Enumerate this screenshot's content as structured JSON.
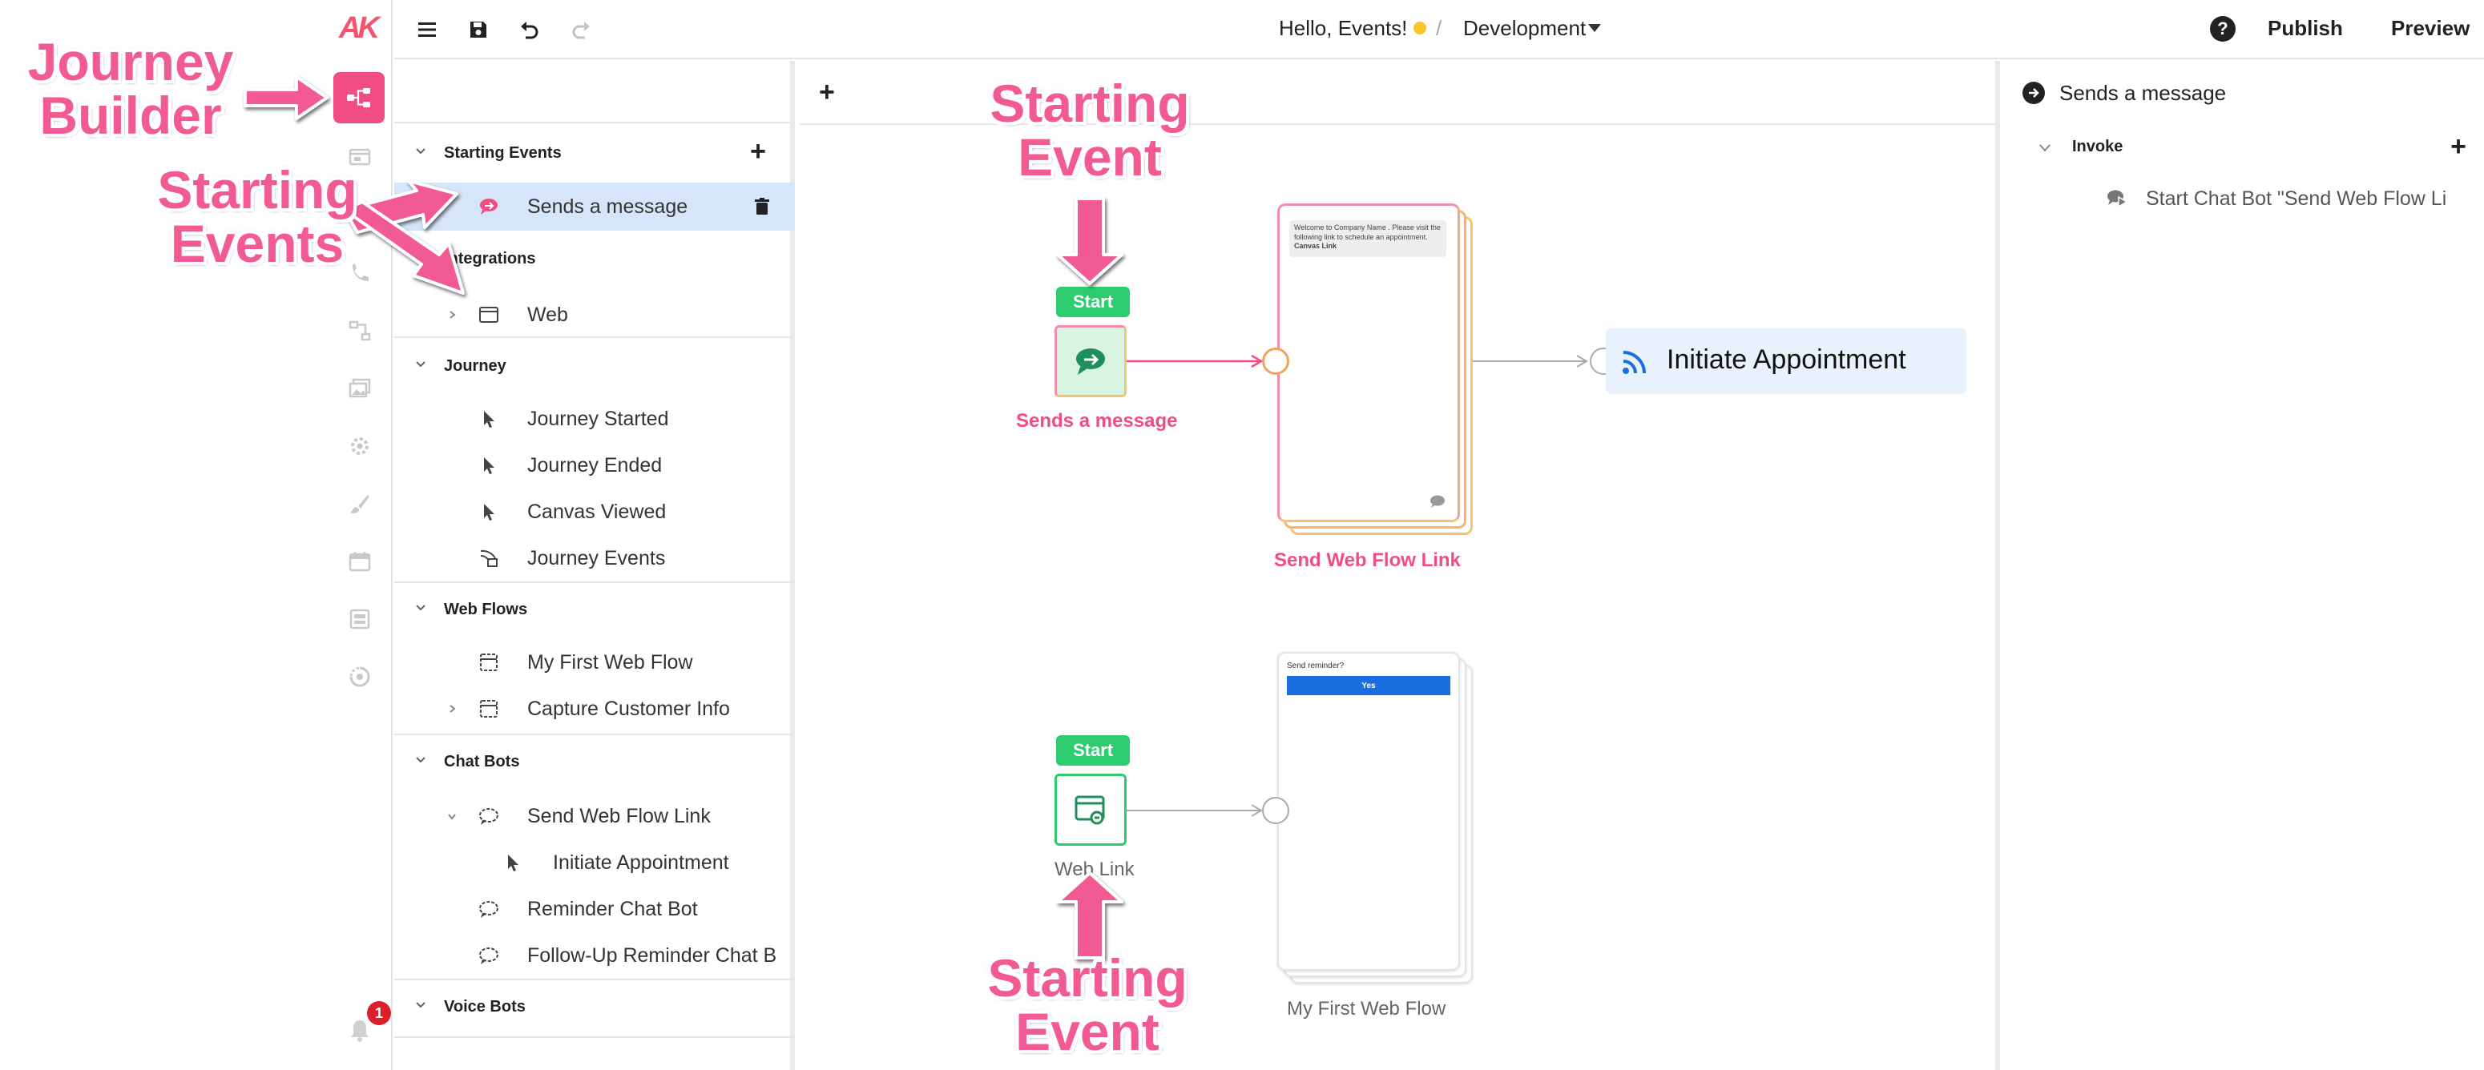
{
  "topbar": {
    "greeting": "Hello, Events!",
    "separator": "/",
    "environment": "Development",
    "help_label": "?",
    "publish_label": "Publish",
    "preview_label": "Preview"
  },
  "rail": {
    "logo": "AK",
    "notification_count": "1"
  },
  "left_panel": {
    "sections": [
      {
        "title": "Starting Events",
        "add": "+"
      },
      {
        "title": "Journey"
      },
      {
        "title": "Web Flows"
      },
      {
        "title": "Chat Bots"
      },
      {
        "title": "Voice Bots"
      }
    ],
    "starting_events": {
      "selected_item": "Sends a message",
      "integrations_title": "Integrations",
      "web_item": "Web"
    },
    "journey_items": [
      "Journey Started",
      "Journey Ended",
      "Canvas Viewed",
      "Journey Events"
    ],
    "web_flow_items": [
      "My First Web Flow",
      "Capture Customer Info"
    ],
    "chat_bot_items": [
      "Send Web Flow Link",
      "Initiate Appointment",
      "Reminder Chat Bot",
      "Follow-Up Reminder Chat B"
    ]
  },
  "canvas": {
    "add": "+",
    "flow1": {
      "start": "Start",
      "trigger_label": "Sends a message",
      "card_label": "Send Web Flow Link",
      "card_preview_text": "Welcome to   Company Name   . Please visit the following link to schedule an appointment.",
      "card_preview_link": "Canvas Link",
      "target_label": "Initiate Appointment"
    },
    "flow2": {
      "start": "Start",
      "trigger_label": "Web Link",
      "card_label": "My First Web Flow",
      "card_question": "Send reminder?",
      "card_button": "Yes"
    }
  },
  "right_panel": {
    "title": "Sends a message",
    "invoke_title": "Invoke",
    "invoke_add": "+",
    "invoke_item": "Start Chat Bot \"Send Web Flow Li"
  },
  "annotations": {
    "journey_builder": [
      "Journey",
      "Builder"
    ],
    "starting_events": [
      "Starting",
      "Events"
    ],
    "starting_event_top": [
      "Starting",
      "Event"
    ],
    "starting_event_bottom": [
      "Starting",
      "Event"
    ]
  },
  "colors": {
    "accent_pink": "#f04e83",
    "annotation_pink": "#f25a93",
    "start_green": "#2ecc71",
    "selected_blue": "#d6e5fa",
    "status_yellow": "#f8c52a",
    "badge_red": "#d9202b",
    "target_bg": "#e8f1fc"
  }
}
